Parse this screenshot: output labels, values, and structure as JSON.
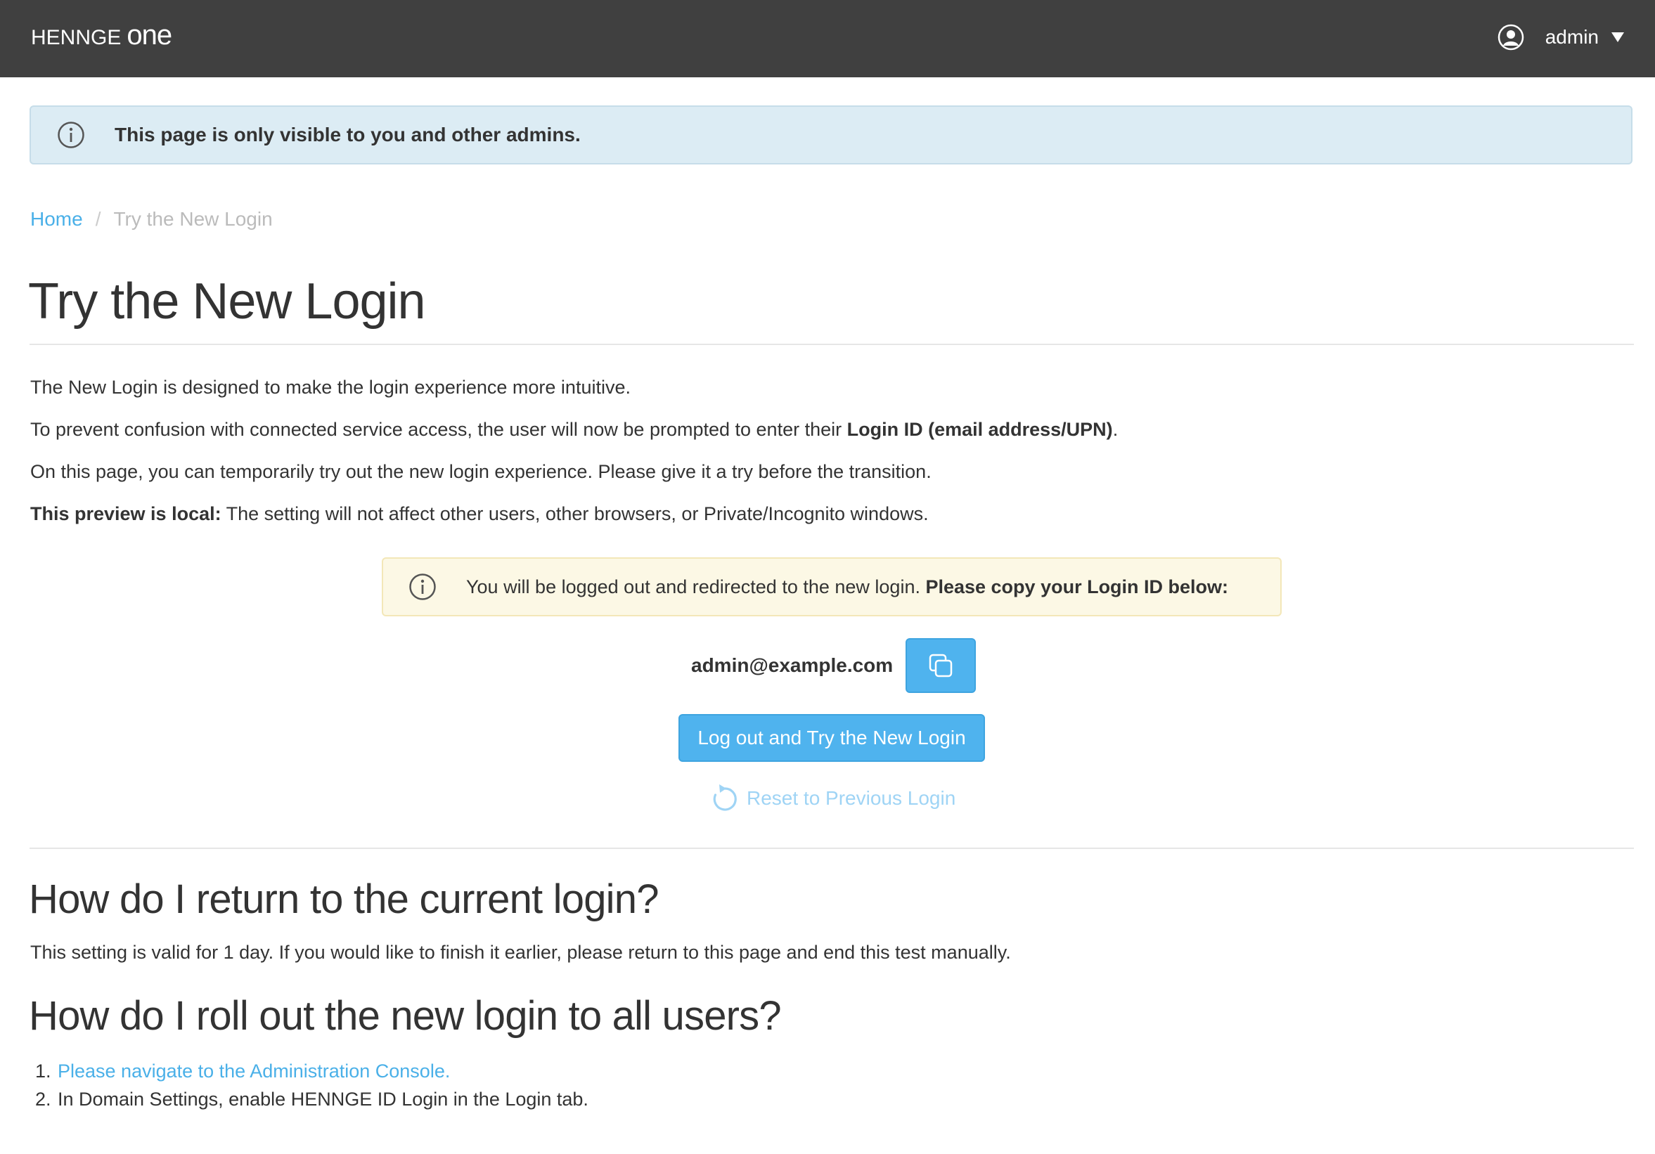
{
  "header": {
    "logo_brand": "HENNGE",
    "logo_product": "one",
    "username": "admin"
  },
  "admin_notice": {
    "text": "This page is only visible to you and other admins."
  },
  "breadcrumb": {
    "home": "Home",
    "separator": "/",
    "current": "Try the New Login"
  },
  "page": {
    "title": "Try the New Login",
    "intro": {
      "p1": "The New Login is designed to make the login experience more intuitive.",
      "p2_prefix": "To prevent confusion with connected service access, the user will now be prompted to enter their ",
      "p2_bold": "Login ID (email address/UPN)",
      "p2_suffix": ".",
      "p3": "On this page, you can temporarily try out the new login experience. Please give it a try before the transition.",
      "p4_bold": "This preview is local:",
      "p4_rest": " The setting will not affect other users, other browsers, or Private/Incognito windows."
    },
    "warning": {
      "text": "You will be logged out and redirected to the new login. ",
      "bold": "Please copy your Login ID below:"
    },
    "login_id": "admin@example.com",
    "primary_button": "Log out and Try the New Login",
    "reset_link": "Reset to Previous Login"
  },
  "faq": {
    "q1_title": "How do I return to the current login?",
    "q1_answer": "This setting is valid for 1 day. If you would like to finish it earlier, please return to this page and end this test manually.",
    "q2_title": "How do I roll out the new login to all users?",
    "steps": [
      {
        "num": "1.",
        "text": "Please navigate to the Administration Console.",
        "link": true
      },
      {
        "num": "2.",
        "text": "In Domain Settings, enable HENNGE ID Login in the Login tab.",
        "link": false
      }
    ]
  },
  "colors": {
    "topbar": "#404040",
    "accent": "#4fb3ee",
    "link": "#4ab0e8",
    "info_bg": "#dcecf4",
    "warn_bg": "#fcf8e5"
  },
  "icons": {
    "user": "user-circle-icon",
    "caret": "caret-down-icon",
    "info": "info-circle-icon",
    "copy": "copy-icon",
    "reset": "refresh-icon"
  }
}
